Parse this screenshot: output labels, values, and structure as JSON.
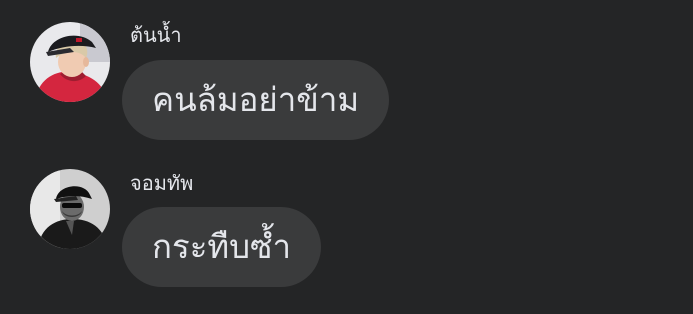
{
  "messages": [
    {
      "sender": "ต้นน้ำ",
      "text": "คนล้มอย่าข้าม"
    },
    {
      "sender": "จอมทัพ",
      "text": "กระทืบซ้ำ"
    }
  ],
  "colors": {
    "background": "#242526",
    "bubble": "#3a3b3c",
    "text": "#e4e6eb"
  }
}
